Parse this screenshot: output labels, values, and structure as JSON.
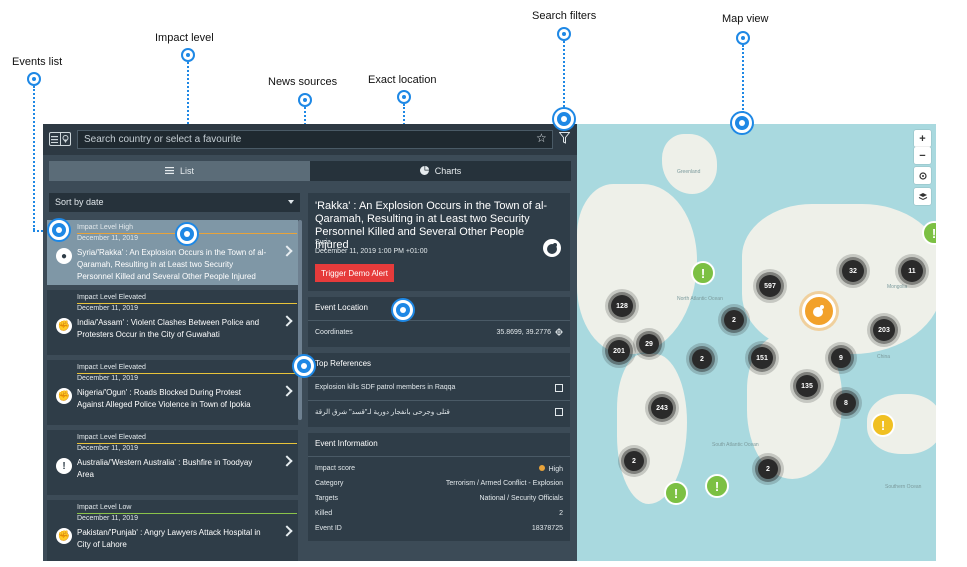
{
  "callouts": {
    "events_list": "Events list",
    "impact_level": "Impact level",
    "news_sources": "News sources",
    "exact_location": "Exact location",
    "search_filters": "Search filters",
    "map_view": "Map view"
  },
  "search": {
    "placeholder": "Search country or select a favourite"
  },
  "tabs": {
    "list": "List",
    "charts": "Charts"
  },
  "sort": {
    "label": "Sort by date"
  },
  "events": [
    {
      "level": "Impact Level High",
      "date": "December 11, 2019",
      "title": "Syria/'Rakka' : An Explosion Occurs in the Town of al-Qaramah, Resulting in at Least two Security Personnel Killed and Several Other People Injured",
      "level_color": "#e8a33a",
      "icon": "explosion-icon"
    },
    {
      "level": "Impact Level Elevated",
      "date": "December 11, 2019",
      "title": "India/'Assam' : Violent Clashes Between Police and Protesters Occur in the City of Guwahati",
      "level_color": "#e8c33a",
      "icon": "protest-fist-icon"
    },
    {
      "level": "Impact Level Elevated",
      "date": "December 11, 2019",
      "title": "Nigeria/'Ogun' : Roads Blocked During Protest Against Alleged Police Violence in Town of Ipokia",
      "level_color": "#e8c33a",
      "icon": "protest-fist-icon"
    },
    {
      "level": "Impact Level Elevated",
      "date": "December 11, 2019",
      "title": "Australia/'Western Australia' : Bushfire in Toodyay Area",
      "level_color": "#e8c33a",
      "icon": "exclamation-icon"
    },
    {
      "level": "Impact Level Low",
      "date": "December 11, 2019",
      "title": "Pakistan/'Punjab' : Angry Lawyers Attack Hospital in City of Lahore",
      "level_color": "#8bc34a",
      "icon": "protest-fist-icon"
    }
  ],
  "detail": {
    "title": "'Rakka' : An Explosion Occurs in the Town of al-Qaramah, Resulting in at Least two Security Personnel Killed and Several Other People Injured",
    "country": "Syria",
    "time": "December 11, 2019 1:00 PM +01:00",
    "demo_button": "Trigger Demo Alert",
    "location": {
      "heading": "Event Location",
      "coord_label": "Coordinates",
      "coord_value": "35.8699, 39.2776"
    },
    "references": {
      "heading": "Top References",
      "items": [
        "Explosion kills SDF patrol members in Raqqa",
        "قتلى وجرحى بانفجار دورية لـ\"قسد\" شرق الرقة"
      ]
    },
    "info": {
      "heading": "Event Information",
      "rows": [
        {
          "label": "Impact score",
          "value": "High"
        },
        {
          "label": "Category",
          "value": "Terrorism / Armed Conflict - Explosion"
        },
        {
          "label": "Targets",
          "value": "National / Security Officials"
        },
        {
          "label": "Killed",
          "value": "2"
        },
        {
          "label": "Event ID",
          "value": "18378725"
        }
      ]
    }
  },
  "map": {
    "labels": {
      "greenland": "Greenland",
      "north_atlantic": "North Atlantic Ocean",
      "south_atlantic": "South Atlantic Ocean",
      "mongolia": "Mongolia",
      "china": "China",
      "southern_ocean": "Southern Ocean"
    },
    "clusters": [
      "128",
      "201",
      "29",
      "2",
      "597",
      "151",
      "135",
      "9",
      "32",
      "11",
      "203",
      "243",
      "8",
      "2",
      "2",
      "2"
    ],
    "controls": {
      "zoom_in": "+",
      "zoom_out": "−"
    }
  },
  "colors": {
    "high": "#e8a33a",
    "elevated": "#e8c33a",
    "low": "#8bc34a",
    "accent": "#1e88e5",
    "alert_red": "#e63b3b"
  }
}
